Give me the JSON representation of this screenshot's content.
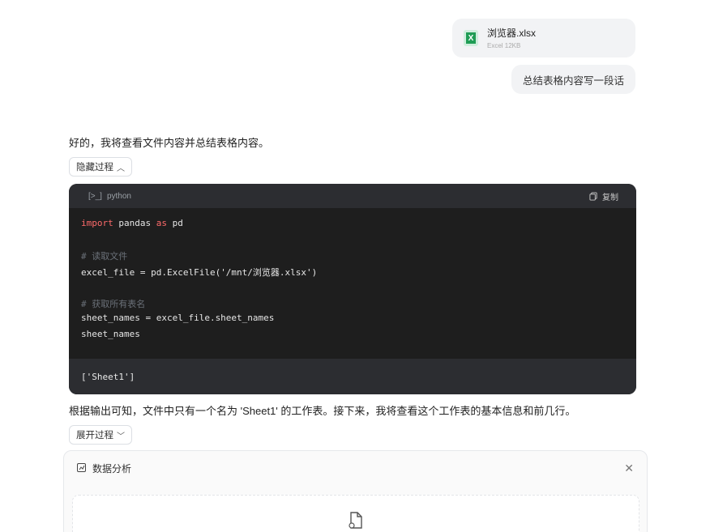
{
  "attachment": {
    "name": "浏览器.xlsx",
    "meta": "Excel 12KB",
    "icon_letter": "X"
  },
  "user_message": "总结表格内容写一段话",
  "assistant": {
    "intro": "好的，我将查看文件内容并总结表格内容。",
    "hide_process": "隐藏过程",
    "code": {
      "lang": "python",
      "copy_label": "复制",
      "output": "['Sheet1']"
    },
    "followup": "根据输出可知，文件中只有一个名为 'Sheet1' 的工作表。接下来，我将查看这个工作表的基本信息和前几行。",
    "expand_process": "展开过程"
  },
  "analysis_panel": {
    "title": "数据分析"
  }
}
